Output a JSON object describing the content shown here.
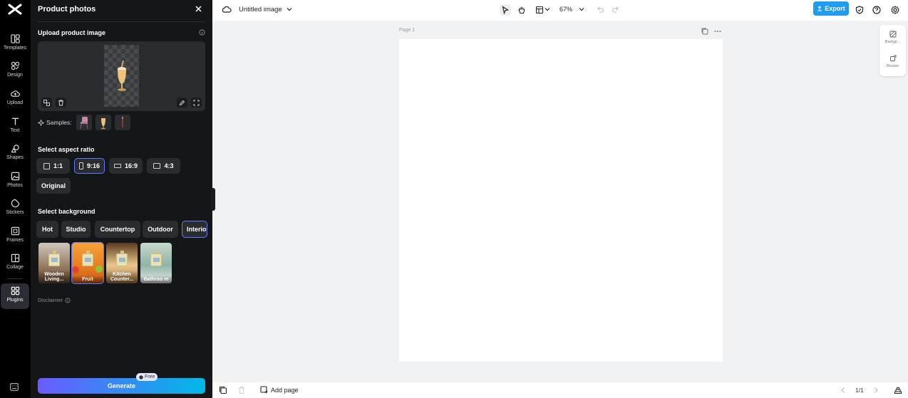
{
  "rail": {
    "items": [
      {
        "label": "Templates"
      },
      {
        "label": "Design"
      },
      {
        "label": "Upload"
      },
      {
        "label": "Text"
      },
      {
        "label": "Shapes"
      },
      {
        "label": "Photos"
      },
      {
        "label": "Stickers"
      },
      {
        "label": "Frames"
      },
      {
        "label": "Collage"
      },
      {
        "label": "Plugins"
      }
    ]
  },
  "panel": {
    "title": "Product photos",
    "upload_label": "Upload product image",
    "samples_label": "Samples:",
    "aspect_label": "Select aspect ratio",
    "aspect_options": [
      "1:1",
      "9:16",
      "16:9",
      "4:3",
      "Original"
    ],
    "aspect_selected": "9:16",
    "background_label": "Select background",
    "background_tabs": [
      "Hot",
      "Studio",
      "Countertop",
      "Outdoor",
      "Interior"
    ],
    "background_selected_tab": "Interior",
    "thumbnails": [
      {
        "label": "Wooden Living..."
      },
      {
        "label": "Fruit"
      },
      {
        "label": "Kitchen Counter..."
      },
      {
        "label": "Bathroo m"
      }
    ],
    "thumbnail_selected": "Fruit",
    "disclaimer": "Disclaimer",
    "generate_label": "Generate",
    "free_badge": "Free"
  },
  "topbar": {
    "doc_title": "Untitled image",
    "zoom": "67%",
    "export_label": "Export"
  },
  "canvas": {
    "page_label": "Page 1"
  },
  "side_tools": {
    "items": [
      {
        "label": "Backgr..."
      },
      {
        "label": "Resize"
      }
    ]
  },
  "bottombar": {
    "add_page_label": "Add page",
    "pager": "1/1"
  },
  "colors": {
    "accent": "#1f9cf0",
    "selected_outline": "#5b7cff",
    "panel_bg": "#151618"
  }
}
